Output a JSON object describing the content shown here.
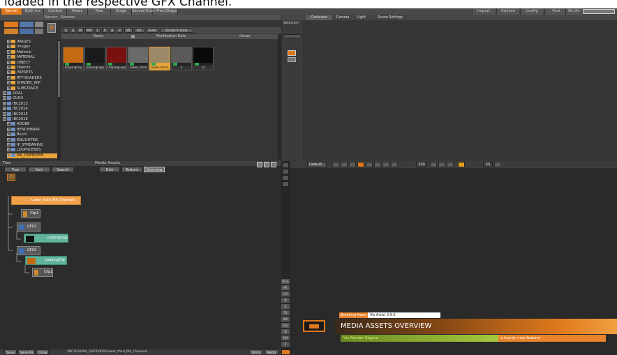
{
  "caption": "loaded in the respective GFX Channel.",
  "menubar": {
    "tabs": [
      "Server",
      "Built Ins",
      "Control",
      "Views",
      "Tree",
      "Stage",
      "Server/Stage",
      "+Tree/Stage"
    ],
    "right_buttons": [
      "Import",
      "Archive",
      "Config",
      "Post",
      "On Air"
    ]
  },
  "server": {
    "header": "Server : Scenes",
    "filter_tabs": [
      "S",
      "G",
      "M",
      "MA",
      "I",
      "F",
      "A",
      "V",
      "SB",
      "All",
      "Auto",
      "Guest's View"
    ],
    "columns": [
      "Name",
      "Modification Date",
      "Owner"
    ],
    "tree": [
      {
        "label": "IMAGES",
        "indent": 1,
        "color": "orange"
      },
      {
        "label": "Images",
        "indent": 1,
        "color": "orange"
      },
      {
        "label": "Material",
        "indent": 1,
        "color": "orange"
      },
      {
        "label": "MATERIAL",
        "indent": 1,
        "color": "orange"
      },
      {
        "label": "OBJECT",
        "indent": 1,
        "color": "orange"
      },
      {
        "label": "Objects",
        "indent": 1,
        "color": "orange"
      },
      {
        "label": "PRESETS",
        "indent": 1,
        "color": "orange"
      },
      {
        "label": "RTT-SHADERS",
        "indent": 1,
        "color": "orange"
      },
      {
        "label": "SHADER_WIP",
        "indent": 1,
        "color": "orange"
      },
      {
        "label": "SUBSTANCE",
        "indent": 1,
        "color": "orange"
      },
      {
        "label": "GOAL",
        "indent": 0,
        "color": "blue"
      },
      {
        "label": "GURU",
        "indent": 0,
        "color": "blue"
      },
      {
        "label": "IBC2013",
        "indent": 0,
        "color": "blue"
      },
      {
        "label": "IBC2014",
        "indent": 0,
        "color": "blue"
      },
      {
        "label": "IBC2015",
        "indent": 0,
        "color": "blue"
      },
      {
        "label": "IBC2016",
        "indent": 0,
        "color": "blue"
      },
      {
        "label": "ADOBE",
        "indent": 1,
        "color": "blue"
      },
      {
        "label": "BENCHMARK",
        "indent": 1,
        "color": "blue"
      },
      {
        "label": "Blurrr",
        "indent": 1,
        "color": "blue"
      },
      {
        "label": "ENLIGHTEN",
        "indent": 1,
        "color": "blue"
      },
      {
        "label": "IP_STREAMING",
        "indent": 1,
        "color": "blue"
      },
      {
        "label": "LOOPSCENES",
        "indent": 1,
        "color": "blue"
      },
      {
        "label": "MA_OVERVIEW",
        "indent": 1,
        "color": "blue",
        "selected": true
      }
    ],
    "thumbs": [
      {
        "label": "LoopingClip",
        "color": "#c46a12"
      },
      {
        "label": "LoopingLogo",
        "color": "#1b1b1b"
      },
      {
        "label": "LoopingLogo",
        "color": "#7a1010"
      },
      {
        "label": "Lower_third",
        "color": "#6a6a6a"
      },
      {
        "label": "Lower_third_",
        "color": "#9a8a6a",
        "selected": true
      },
      {
        "label": "o",
        "color": "#5a5a5a"
      },
      {
        "label": "s2",
        "color": "#0a0a0a"
      }
    ]
  },
  "right_top": {
    "tabs": [
      "Container",
      "Camera",
      "Light",
      "Scene Settings"
    ],
    "selection_label": "Selection"
  },
  "tree_panel": {
    "header": "Tree",
    "buttons": [
      "Tree",
      "Sort",
      "Search"
    ],
    "nodes": [
      {
        "label": "Lower_third_MA_Channels",
        "kind": "root"
      },
      {
        "label": "Clip1",
        "kind": "clip"
      },
      {
        "label": "GFX1",
        "kind": "gfx"
      },
      {
        "label": "LoopingLogo",
        "kind": "scene"
      },
      {
        "label": "GFX2",
        "kind": "gfx"
      },
      {
        "label": "LoopingClip",
        "kind": "scene"
      },
      {
        "label": "Clip1",
        "kind": "clip"
      }
    ]
  },
  "media_assets": {
    "header": "Media Assets",
    "buttons": [
      "Disk",
      "Texture",
      "Overview"
    ]
  },
  "render_toolbar": {
    "preset": "Default",
    "fps": "100",
    "zoom": "50"
  },
  "side_labels": [
    "Rma",
    "PR",
    "SCF",
    "N",
    "E",
    "TA",
    "SW",
    "Key",
    "W",
    "DM",
    "P"
  ],
  "lower_third": {
    "breaking": "Breaking News",
    "version": "Viz Artist 3.9.0",
    "title": "MEDIA ASSETS OVERVIEW",
    "left_sub": "Viz Render Engine",
    "right_sub": "a handy new feature"
  },
  "statusbar": {
    "buttons": [
      "Save",
      "Save As",
      "Close"
    ],
    "path": "/IBC2016/MA_OVERVIEW/Lower_third_MA_Channels",
    "right_buttons": [
      "Undo",
      "Redo"
    ]
  }
}
